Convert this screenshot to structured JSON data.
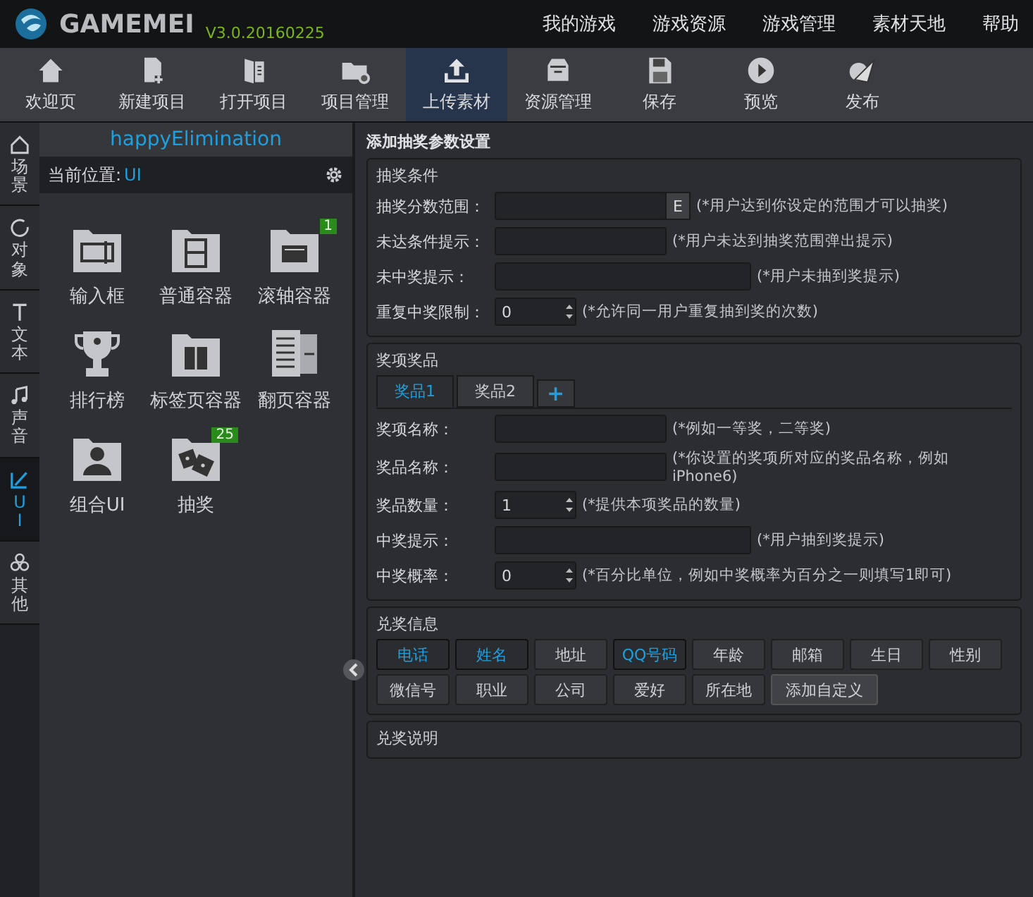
{
  "app": {
    "logo_text": "GAMEMEI",
    "version": "V3.0.20160225"
  },
  "menu": [
    "我的游戏",
    "游戏资源",
    "游戏管理",
    "素材天地",
    "帮助"
  ],
  "toolbar": [
    {
      "label": "欢迎页",
      "selected": false
    },
    {
      "label": "新建项目",
      "selected": false
    },
    {
      "label": "打开项目",
      "selected": false
    },
    {
      "label": "项目管理",
      "selected": false
    },
    {
      "label": "上传素材",
      "selected": true
    },
    {
      "label": "资源管理",
      "selected": false
    },
    {
      "label": "保存",
      "selected": false
    },
    {
      "label": "预览",
      "selected": false
    },
    {
      "label": "发布",
      "selected": false
    }
  ],
  "side_tabs": [
    {
      "label": "场景",
      "selected": false
    },
    {
      "label": "对象",
      "selected": false
    },
    {
      "label": "文本",
      "selected": false
    },
    {
      "label": "声音",
      "selected": false
    },
    {
      "label": "UI",
      "selected": true
    },
    {
      "label": "其他",
      "selected": false
    }
  ],
  "panel": {
    "project": "happyElimination",
    "location_label": "当前位置:",
    "location_value": "UI",
    "items": [
      {
        "label": "输入框"
      },
      {
        "label": "普通容器"
      },
      {
        "label": "滚轴容器",
        "badge": "1"
      },
      {
        "label": "排行榜"
      },
      {
        "label": "标签页容器"
      },
      {
        "label": "翻页容器"
      },
      {
        "label": "组合UI"
      },
      {
        "label": "抽奖",
        "badge": "25"
      }
    ]
  },
  "dialog": {
    "title": "添加抽奖参数设置",
    "conditions": {
      "legend": "抽奖条件",
      "rows": [
        {
          "kind": "text",
          "label": "抽奖分数范围：",
          "button": "E",
          "hint": "(*用户达到你设定的范围才可以抽奖)"
        },
        {
          "kind": "text",
          "label": "未达条件提示：",
          "hint": "(*用户未达到抽奖范围弹出提示)"
        },
        {
          "kind": "wide",
          "label": "未中奖提示：",
          "hint": "(*用户未抽到奖提示)"
        },
        {
          "kind": "spin",
          "label": "重复中奖限制：",
          "value": "0",
          "hint": "(*允许同一用户重复抽到奖的次数)"
        }
      ]
    },
    "prizes": {
      "legend": "奖项奖品",
      "tabs": [
        {
          "label": "奖品1",
          "selected": true
        },
        {
          "label": "奖品2",
          "selected": false
        }
      ],
      "add": "+",
      "rows": [
        {
          "kind": "text",
          "label": "奖项名称：",
          "hint": "(*例如一等奖，二等奖)"
        },
        {
          "kind": "text",
          "label": "奖品名称：",
          "hint": "(*你设置的奖项所对应的奖品名称，例如iPhone6)"
        },
        {
          "kind": "spin",
          "label": "奖品数量：",
          "value": "1",
          "hint": "(*提供本项奖品的数量)"
        },
        {
          "kind": "wide",
          "label": "中奖提示：",
          "hint": "(*用户抽到奖提示)"
        },
        {
          "kind": "spin",
          "label": "中奖概率：",
          "value": "0",
          "hint": "(*百分比单位，例如中奖概率为百分之一则填写1即可)"
        }
      ]
    },
    "redeem": {
      "legend": "兑奖信息",
      "rows": [
        [
          {
            "kind": "chip",
            "label": "电话",
            "selected": true
          },
          {
            "kind": "chip",
            "label": "姓名",
            "selected": true
          },
          {
            "kind": "chip",
            "label": "地址",
            "selected": false
          },
          {
            "kind": "chip",
            "label": "QQ号码",
            "selected": true
          },
          {
            "kind": "chip",
            "label": "年龄",
            "selected": false
          },
          {
            "kind": "chip",
            "label": "邮箱",
            "selected": false
          },
          {
            "kind": "chip",
            "label": "生日",
            "selected": false
          },
          {
            "kind": "chip",
            "label": "性别",
            "selected": false
          }
        ],
        [
          {
            "kind": "chip",
            "label": "微信号",
            "selected": false
          },
          {
            "kind": "chip",
            "label": "职业",
            "selected": false
          },
          {
            "kind": "chip",
            "label": "公司",
            "selected": false
          },
          {
            "kind": "chip",
            "label": "爱好",
            "selected": false
          },
          {
            "kind": "chip",
            "label": "所在地",
            "selected": false
          },
          {
            "kind": "add",
            "label": "添加自定义"
          }
        ]
      ]
    },
    "notes": {
      "legend": "兑奖说明"
    }
  }
}
